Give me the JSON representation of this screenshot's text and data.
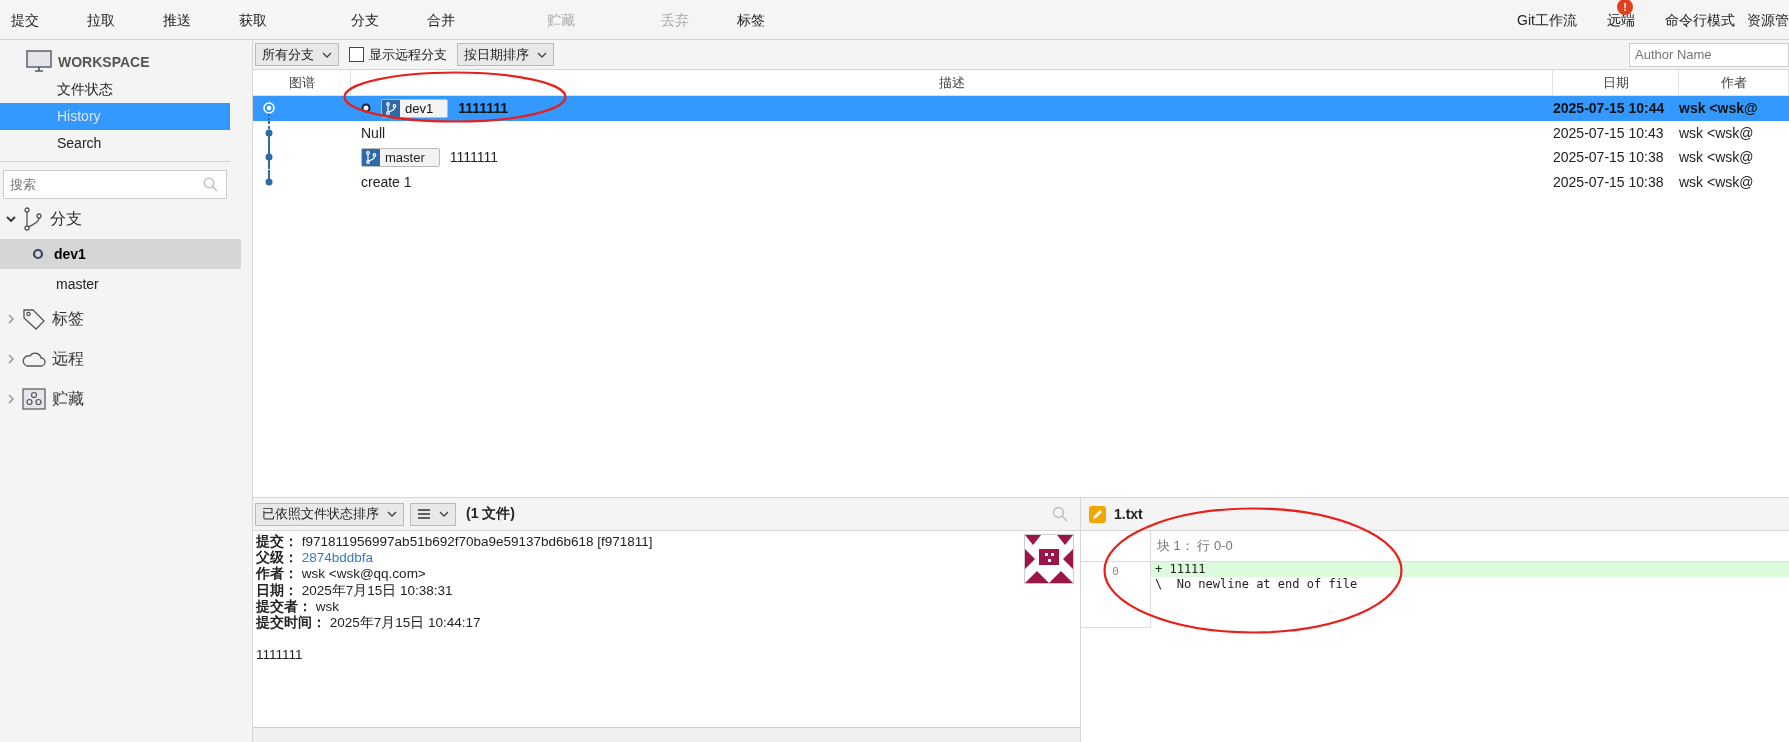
{
  "toolbar": {
    "items": [
      {
        "label": "提交",
        "disabled": false
      },
      {
        "label": "拉取",
        "disabled": false
      },
      {
        "label": "推送",
        "disabled": false
      },
      {
        "label": "获取",
        "disabled": false
      },
      {
        "label": "分支",
        "disabled": false
      },
      {
        "label": "合并",
        "disabled": false
      },
      {
        "label": "贮藏",
        "disabled": true
      },
      {
        "label": "丢弃",
        "disabled": true
      },
      {
        "label": "标签",
        "disabled": false
      }
    ],
    "right_items": [
      {
        "label": "Git工作流"
      },
      {
        "label": "远端",
        "badge": "!"
      },
      {
        "label": "命令行模式"
      },
      {
        "label": "资源管"
      }
    ]
  },
  "sidebar": {
    "workspace": {
      "title": "WORKSPACE",
      "items": [
        {
          "label": "文件状态",
          "selected": false
        },
        {
          "label": "History",
          "selected": true
        },
        {
          "label": "Search",
          "selected": false
        }
      ]
    },
    "search": {
      "placeholder": "搜索"
    },
    "groups": [
      {
        "kind": "branch",
        "label": "分支",
        "expanded": true,
        "children": [
          {
            "label": "dev1",
            "current": true,
            "selected": true
          },
          {
            "label": "master",
            "current": false,
            "selected": false
          }
        ]
      },
      {
        "kind": "tag",
        "label": "标签",
        "expanded": false
      },
      {
        "kind": "remote",
        "label": "远程",
        "expanded": false
      },
      {
        "kind": "stash",
        "label": "贮藏",
        "expanded": false
      }
    ]
  },
  "filter_bar": {
    "branch_dropdown": "所有分支",
    "remote_checkbox": {
      "label": "显示远程分支",
      "checked": false
    },
    "sort_dropdown": "按日期排序",
    "author_search": {
      "placeholder": "Author Name"
    }
  },
  "table": {
    "columns": [
      "图谱",
      "描述",
      "日期",
      "作者"
    ],
    "rows": [
      {
        "selected": true,
        "head": true,
        "refs": [
          {
            "label": "dev1",
            "current": true
          }
        ],
        "message": "1111111",
        "date": "2025-07-15 10:44",
        "author": "wsk <wsk@"
      },
      {
        "selected": false,
        "head": false,
        "refs": [],
        "message": "Null",
        "date": "2025-07-15 10:43",
        "author": "wsk <wsk@"
      },
      {
        "selected": false,
        "head": false,
        "refs": [
          {
            "label": "master",
            "current": false
          }
        ],
        "message": "1111111",
        "date": "2025-07-15 10:38",
        "author": "wsk <wsk@"
      },
      {
        "selected": false,
        "head": false,
        "refs": [],
        "message": "create 1",
        "date": "2025-07-15 10:38",
        "author": "wsk <wsk@"
      }
    ]
  },
  "details": {
    "sort_dropdown": "已依照文件状态排序",
    "file_count": "(1 文件)",
    "fields": [
      {
        "label": "提交：",
        "value": "f971811956997ab51b692f70ba9e59137bd6b618 [f971811]",
        "kind": "text"
      },
      {
        "label": "父级：",
        "value": "2874bddbfa",
        "kind": "link"
      },
      {
        "label": "作者：",
        "value": "wsk <wsk@qq.com>",
        "kind": "text"
      },
      {
        "label": "日期：",
        "value": "2025年7月15日 10:38:31",
        "kind": "text"
      },
      {
        "label": "提交者：",
        "value": "wsk",
        "kind": "text"
      },
      {
        "label": "提交时间：",
        "value": "2025年7月15日 10:44:17",
        "kind": "text"
      }
    ],
    "message": "1111111"
  },
  "diff": {
    "file": "1.txt",
    "hunk_header": "块 1： 行 0-0",
    "line_number": "0",
    "lines": [
      {
        "kind": "added",
        "text": "+ 11111"
      },
      {
        "kind": "context",
        "text": "\\  No newline at end of file"
      }
    ]
  },
  "annotations": [
    {
      "kind": "ellipse"
    },
    {
      "kind": "ellipse"
    }
  ]
}
